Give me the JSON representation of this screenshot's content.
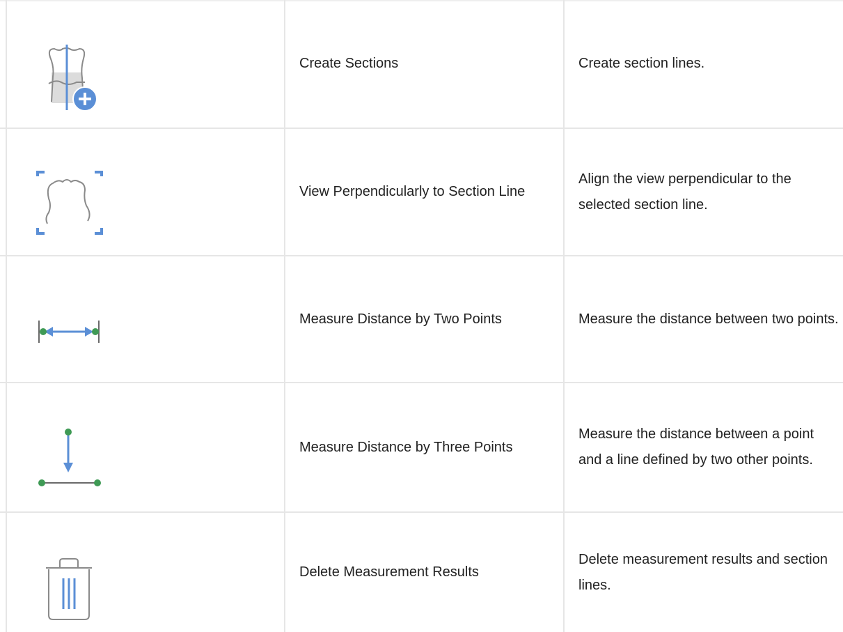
{
  "rows": [
    {
      "name": "Create Sections",
      "description": "Create section lines.",
      "icon": "create-sections-icon"
    },
    {
      "name": "View Perpendicularly to Section Line",
      "description": "Align the view perpendicular to the selected section line.",
      "icon": "view-perpendicular-icon"
    },
    {
      "name": "Measure Distance by Two Points",
      "description": "Measure the distance between two points.",
      "icon": "two-points-distance-icon"
    },
    {
      "name": "Measure Distance by Three Points",
      "description": "Measure the distance between a point and a line defined by two other points.",
      "icon": "three-points-distance-icon"
    },
    {
      "name": "Delete Measurement Results",
      "description": "Delete measurement results and section lines.",
      "icon": "trash-icon"
    }
  ],
  "colors": {
    "accent_blue": "#5b8fd6",
    "point_green": "#3f9a55",
    "outline_gray": "#8a8a8a",
    "grid": "#e6e6e6"
  }
}
